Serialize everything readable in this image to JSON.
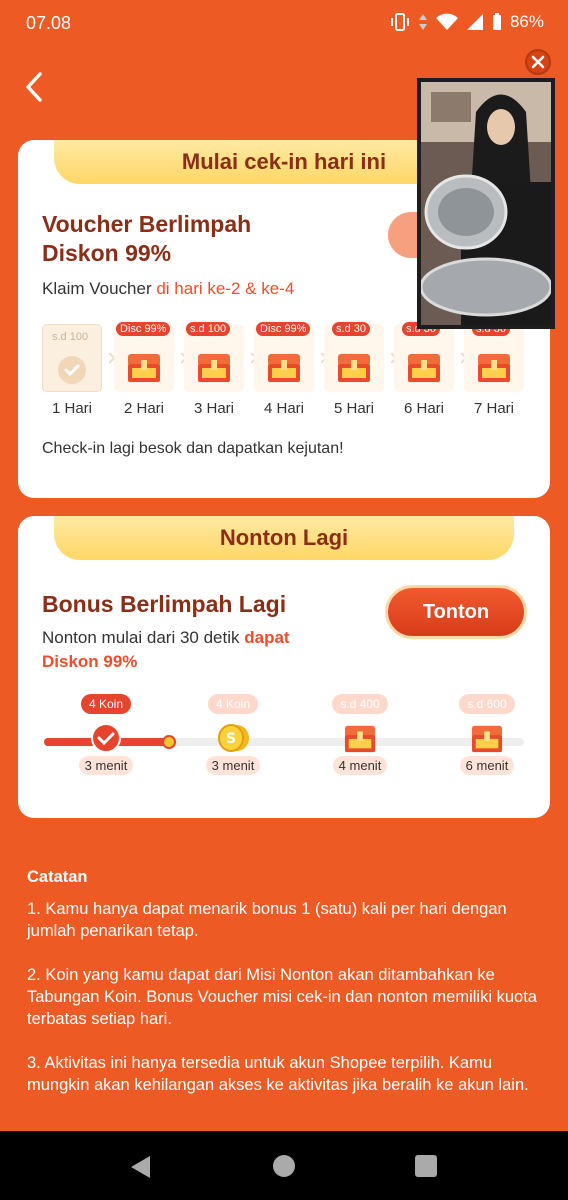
{
  "status_bar": {
    "time": "07.08",
    "battery": "86%"
  },
  "colors": {
    "brand": "#ee5a24",
    "accent": "#e6442d",
    "title": "#8b2e18"
  },
  "checkin": {
    "ribbon": "Mulai cek-in hari ini",
    "title_line1": "Voucher Berlimpah",
    "title_line2": "Diskon 99%",
    "claim_prefix": "Klaim Voucher ",
    "claim_highlight": "di hari ke-2 & ke-4",
    "days": [
      {
        "tag": "s.d 100",
        "label": "1 Hari"
      },
      {
        "tag": "Disc 99%",
        "label": "2 Hari"
      },
      {
        "tag": "s.d 100",
        "label": "3 Hari"
      },
      {
        "tag": "Disc 99%",
        "label": "4 Hari"
      },
      {
        "tag": "s.d 30",
        "label": "5 Hari"
      },
      {
        "tag": "s.d 30",
        "label": "6 Hari"
      },
      {
        "tag": "s.d 30",
        "label": "7 Hari"
      }
    ],
    "footnote": "Check-in lagi besok dan dapatkan kejutan!"
  },
  "watch": {
    "ribbon": "Nonton Lagi",
    "title": "Bonus Berlimpah Lagi",
    "button": "Tonton",
    "desc_prefix": "Nonton mulai dari 30 detik ",
    "desc_highlight_1": "dapat",
    "desc_highlight_2": "Diskon 99%",
    "milestones": [
      {
        "reward": "4 Koin",
        "time": "3 menit"
      },
      {
        "reward": "4 Koin",
        "time": "3 menit"
      },
      {
        "reward": "s.d 400",
        "time": "4 menit"
      },
      {
        "reward": "s.d 600",
        "time": "6 menit"
      }
    ]
  },
  "notes": {
    "title": "Catatan",
    "items": [
      "1. Kamu hanya dapat menarik bonus 1 (satu) kali per hari dengan jumlah penarikan tetap.",
      "2. Koin yang kamu dapat dari Misi Nonton akan ditambahkan ke Tabungan Koin. Bonus Voucher misi cek-in dan nonton memiliki kuota terbatas setiap hari.",
      "3. Aktivitas ini hanya tersedia untuk akun Shopee terpilih. Kamu mungkin akan kehilangan akses ke aktivitas jika beralih ke akun lain."
    ]
  }
}
